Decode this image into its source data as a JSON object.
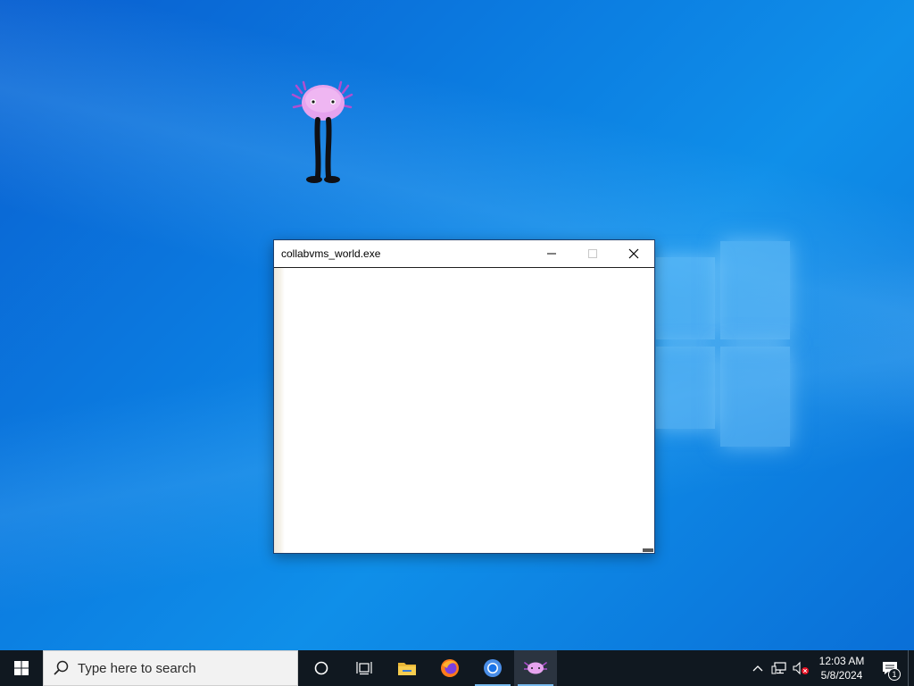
{
  "window": {
    "title": "collabvms_world.exe",
    "minimize_icon": "minimize-icon",
    "maximize_icon": "maximize-icon",
    "close_icon": "close-icon"
  },
  "desktop": {
    "mascot_icon": "axolotl-icon"
  },
  "taskbar": {
    "start_icon": "windows-start-icon",
    "search_placeholder": "Type here to search",
    "apps": [
      {
        "name": "cortana-icon"
      },
      {
        "name": "task-view-icon"
      },
      {
        "name": "file-explorer-icon"
      },
      {
        "name": "firefox-icon"
      },
      {
        "name": "chrome-icon"
      },
      {
        "name": "axolotl-app-icon"
      }
    ],
    "tray": {
      "time": "12:03 AM",
      "date": "5/8/2024",
      "notification_count": "1"
    }
  },
  "colors": {
    "desktop_blue": "#0b7be0",
    "taskbar_bg": "#101820",
    "accent_underline": "#76b9ed"
  }
}
